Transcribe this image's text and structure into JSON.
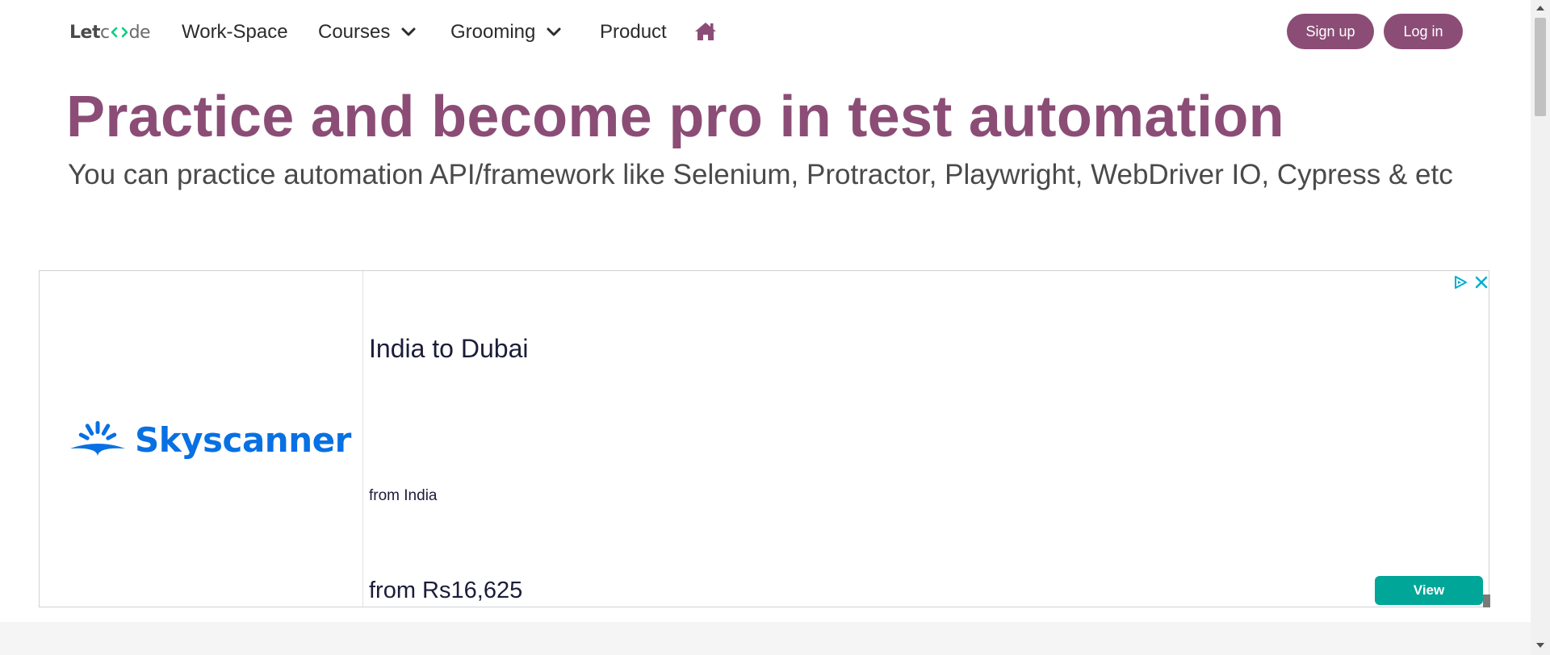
{
  "brand": {
    "part1": "Let",
    "part2": "de"
  },
  "nav": {
    "workspace": "Work-Space",
    "courses": "Courses",
    "grooming": "Grooming",
    "product": "Product",
    "home_icon": "home-icon"
  },
  "auth": {
    "signup": "Sign up",
    "login": "Log in"
  },
  "hero": {
    "title": "Practice and become pro in test automation",
    "subtitle": "You can practice automation API/framework like Selenium, Protractor, Playwright, WebDriver IO, Cypress & etc"
  },
  "ad": {
    "brand": "Skyscanner",
    "title": "India to Dubai",
    "from_label": "from India",
    "price": "from Rs16,625",
    "cta": "View"
  },
  "colors": {
    "primary": "#8b4d76",
    "ad_cta": "#00a698",
    "skyscanner_blue": "#0770e3",
    "letcode_green": "#00d084"
  }
}
